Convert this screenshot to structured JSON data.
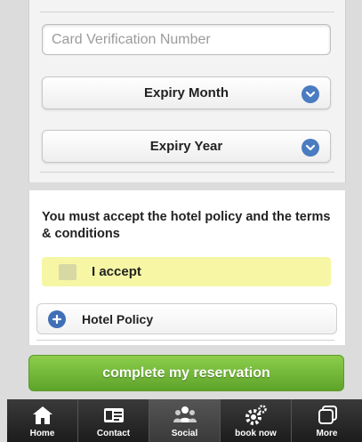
{
  "payment_form": {
    "card_verification": {
      "placeholder": "Card Verification Number",
      "value": ""
    },
    "expiry_month": {
      "label": "Expiry Month"
    },
    "expiry_year": {
      "label": "Expiry Year"
    }
  },
  "terms": {
    "notice": "You must accept the hotel policy and the terms & conditions",
    "accept_label": "I accept",
    "accepted": false,
    "policy_button_label": "Hotel Policy"
  },
  "complete_button": {
    "label": "complete my reservation"
  },
  "bottom_nav": {
    "items": [
      {
        "label": "Home",
        "icon": "home-icon"
      },
      {
        "label": "Contact",
        "icon": "contact-card-icon"
      },
      {
        "label": "Social",
        "icon": "people-icon"
      },
      {
        "label": "book now",
        "icon": "gear-icon"
      },
      {
        "label": "More",
        "icon": "more-icon"
      }
    ]
  },
  "colors": {
    "accent_blue": "#4b7cc1",
    "accept_highlight": "#f6f6a4",
    "complete_green": "#6cb332",
    "nav_background": "#2a2a2a"
  }
}
